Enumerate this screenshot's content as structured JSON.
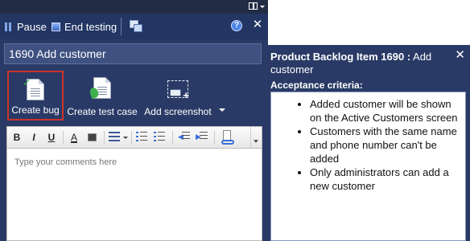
{
  "toolbar": {
    "pause_label": "Pause",
    "end_testing_label": "End testing",
    "help_glyph": "?",
    "close_glyph": "✕"
  },
  "work_item_title": "1690 Add customer",
  "actions": [
    {
      "label": "Create bug",
      "icon": "bug-document-icon",
      "selected": true
    },
    {
      "label": "Create test case",
      "icon": "test-case-document-icon",
      "selected": false
    },
    {
      "label": "Add screenshot",
      "icon": "screenshot-camera-icon",
      "selected": false
    }
  ],
  "format_toolbar": {
    "bold": "B",
    "italic": "I",
    "underline": "U",
    "font_color": "A"
  },
  "comment_placeholder": "Type your comments here",
  "backlog_panel": {
    "heading_prefix": "Product Backlog Item 1690 :",
    "heading_title": "Add customer",
    "close_glyph": "✕",
    "section_label": "Acceptance criteria:",
    "criteria": [
      "Added customer will be shown on the Active Customers screen",
      "Customers with the same name and phone number can't be added",
      "Only administrators can add a new customer"
    ]
  },
  "colors": {
    "panel_background": "#2a3a66",
    "toolbar_background": "#223563",
    "selection_border": "#c8342a"
  }
}
